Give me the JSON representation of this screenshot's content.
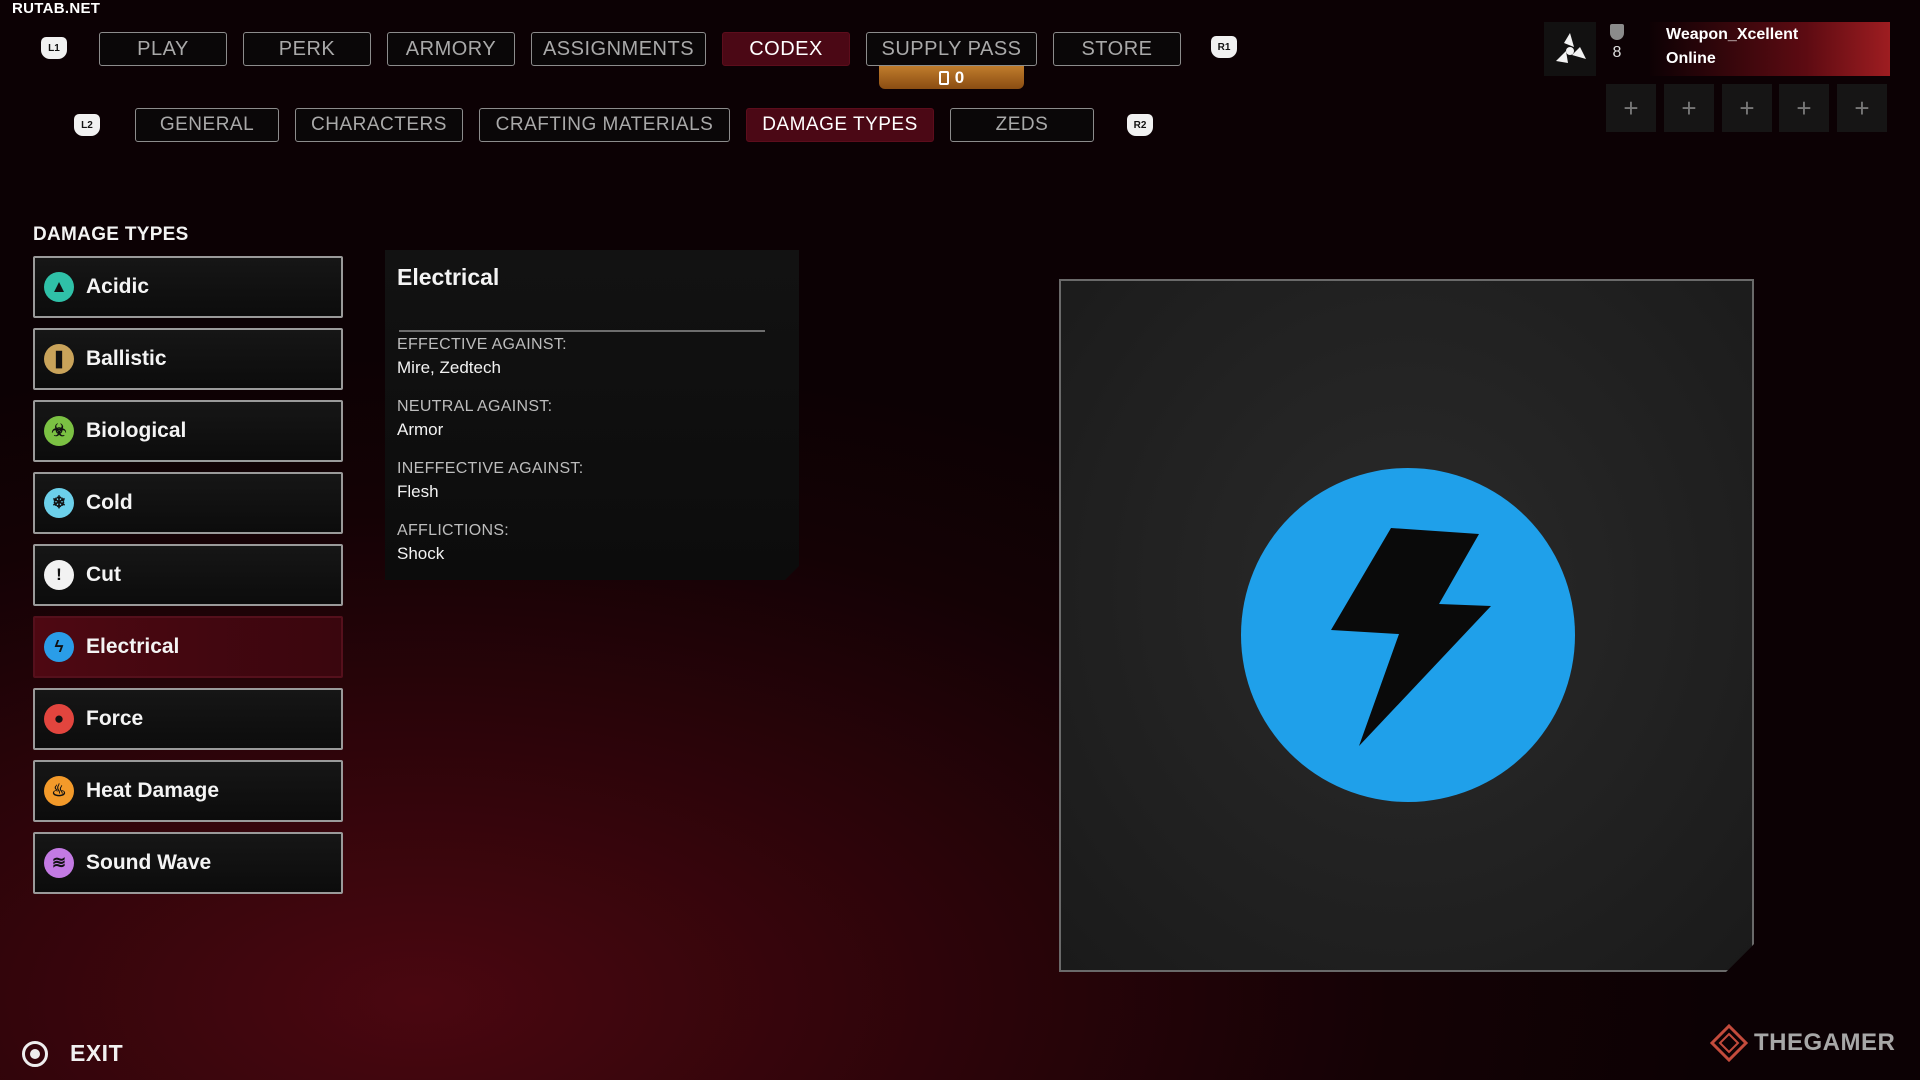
{
  "watermark": "RUTAB.NET",
  "nav": {
    "hint_left": "L1",
    "hint_right": "R1",
    "tabs": [
      {
        "label": "PLAY",
        "active": false
      },
      {
        "label": "PERK",
        "active": false
      },
      {
        "label": "ARMORY",
        "active": false
      },
      {
        "label": "ASSIGNMENTS",
        "active": false
      },
      {
        "label": "CODEX",
        "active": true
      },
      {
        "label": "SUPPLY PASS",
        "active": false
      },
      {
        "label": "STORE",
        "active": false
      }
    ],
    "supply_badge": "0"
  },
  "subnav": {
    "hint_left": "L2",
    "hint_right": "R2",
    "tabs": [
      {
        "label": "GENERAL",
        "active": false
      },
      {
        "label": "CHARACTERS",
        "active": false
      },
      {
        "label": "CRAFTING MATERIALS",
        "active": false
      },
      {
        "label": "DAMAGE TYPES",
        "active": true
      },
      {
        "label": "ZEDS",
        "active": false
      }
    ]
  },
  "profile": {
    "level": "8",
    "name": "Weapon_Xcellent",
    "status": "Online",
    "party_slot_glyph": "+"
  },
  "damage_list": {
    "heading": "DAMAGE TYPES",
    "items": [
      {
        "label": "Acidic",
        "icon": "acidic-icon",
        "color": "#2fc1a8",
        "glyph": "▲",
        "selected": false
      },
      {
        "label": "Ballistic",
        "icon": "ballistic-icon",
        "color": "#c9a35a",
        "glyph": "❚",
        "selected": false
      },
      {
        "label": "Biological",
        "icon": "biohazard-icon",
        "color": "#7bc143",
        "glyph": "☣",
        "selected": false
      },
      {
        "label": "Cold",
        "icon": "snowflake-icon",
        "color": "#6cd0ea",
        "glyph": "❄",
        "selected": false
      },
      {
        "label": "Cut",
        "icon": "blade-icon",
        "color": "#f2f2f2",
        "glyph": "!",
        "selected": false
      },
      {
        "label": "Electrical",
        "icon": "lightning-icon",
        "color": "#2a9de8",
        "glyph": "ϟ",
        "selected": true
      },
      {
        "label": "Force",
        "icon": "fist-icon",
        "color": "#e2453e",
        "glyph": "●",
        "selected": false
      },
      {
        "label": "Heat Damage",
        "icon": "flame-icon",
        "color": "#f39a2a",
        "glyph": "♨",
        "selected": false
      },
      {
        "label": "Sound Wave",
        "icon": "soundwave-icon",
        "color": "#c37ae3",
        "glyph": "≋",
        "selected": false
      }
    ]
  },
  "detail": {
    "title": "Electrical",
    "effective_label": "EFFECTIVE AGAINST:",
    "effective_value": "Mire, Zedtech",
    "neutral_label": "NEUTRAL AGAINST:",
    "neutral_value": "Armor",
    "ineffective_label": "INEFFECTIVE AGAINST:",
    "ineffective_value": "Flesh",
    "afflictions_label": "AFFLICTIONS:",
    "afflictions_value": "Shock"
  },
  "preview": {
    "icon": "lightning-bolt-icon",
    "circle_color": "#1fa0ea"
  },
  "footer": {
    "exit_label": "EXIT",
    "brand": "THEGAMER"
  }
}
